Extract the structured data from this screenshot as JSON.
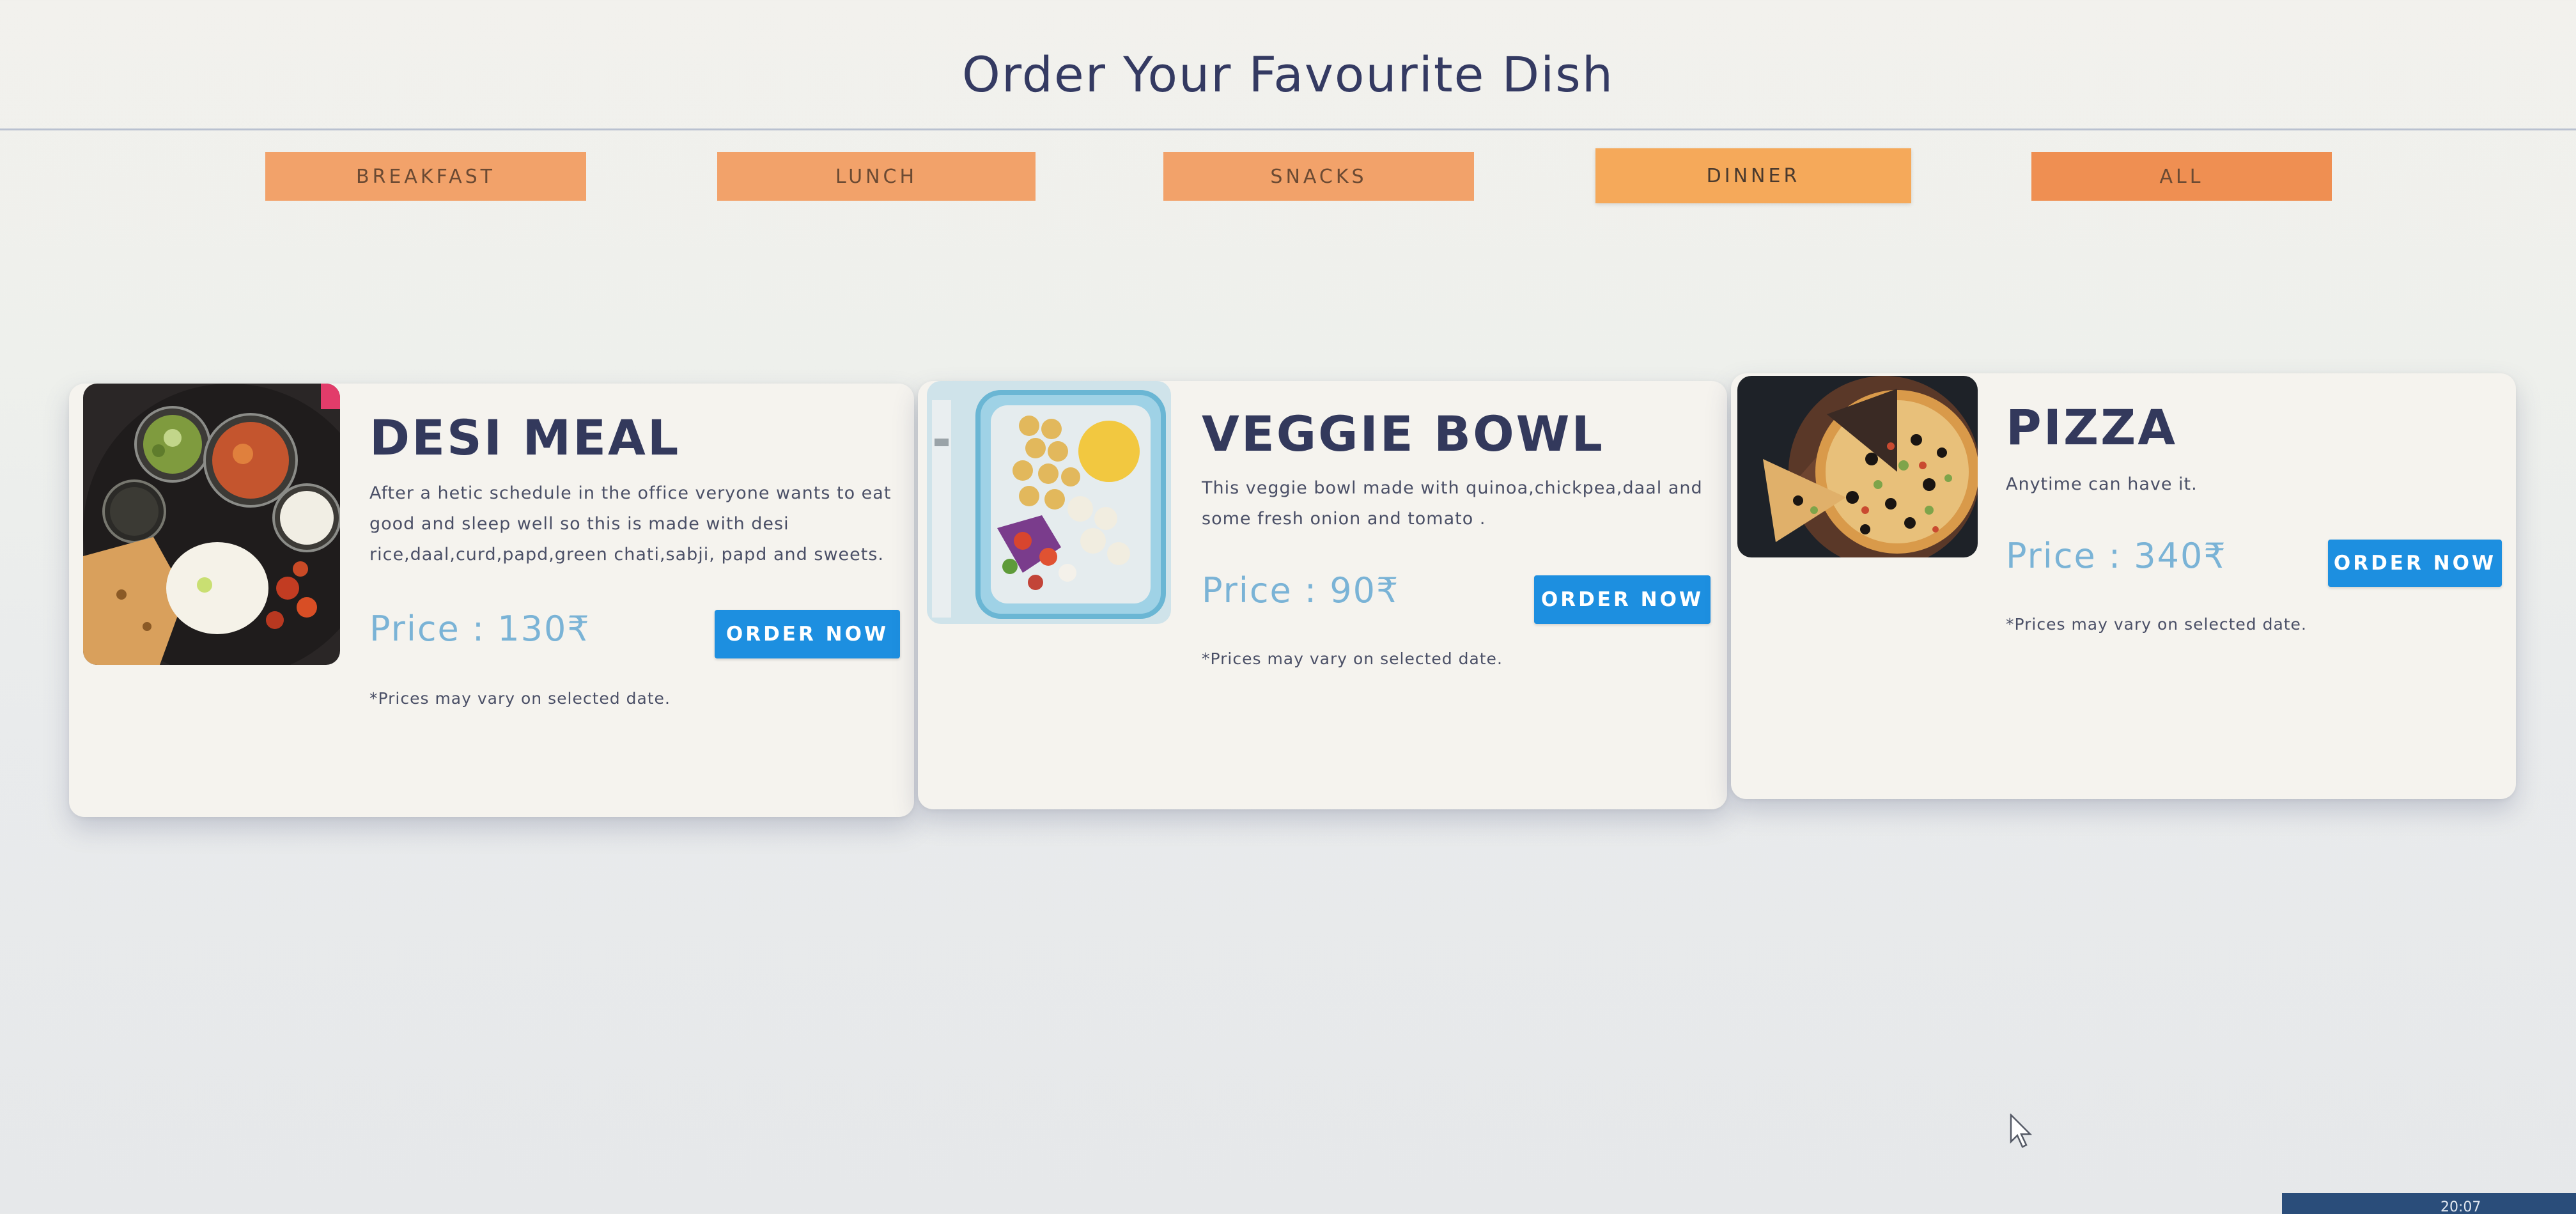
{
  "header": {
    "title": "Order Your Favourite Dish"
  },
  "tabs": [
    {
      "label": "BREAKFAST",
      "active": false
    },
    {
      "label": "LUNCH",
      "active": false
    },
    {
      "label": "SNACKS",
      "active": false
    },
    {
      "label": "DINNER",
      "active": true
    },
    {
      "label": "ALL",
      "active": false
    }
  ],
  "dishes": [
    {
      "title": "DESI MEAL",
      "description": "After a hetic schedule in the office veryone wants to eat good and sleep well so this is made with desi rice,daal,curd,papd,green chati,sabji, papd and sweets.",
      "price": "Price : 130₹",
      "button": "ORDER NOW",
      "note": "*Prices may vary on selected date.",
      "image": "thali-plate-icon"
    },
    {
      "title": "VEGGIE BOWL",
      "description": "This veggie bowl made with quinoa,chickpea,daal and some fresh onion and tomato .",
      "price": "Price : 90₹",
      "button": "ORDER NOW",
      "note": "*Prices may vary on selected date.",
      "image": "veggie-bowl-icon"
    },
    {
      "title": "PIZZA",
      "description": "Anytime can have it.",
      "price": "Price : 340₹",
      "button": "ORDER NOW",
      "note": "*Prices may vary on selected date.",
      "image": "pizza-icon"
    }
  ],
  "colors": {
    "tab": "#f2a26a",
    "button": "#1d8fe0",
    "price": "#7ab3d6",
    "title": "#33395c"
  },
  "taskbar": {
    "clock": "20:07"
  }
}
